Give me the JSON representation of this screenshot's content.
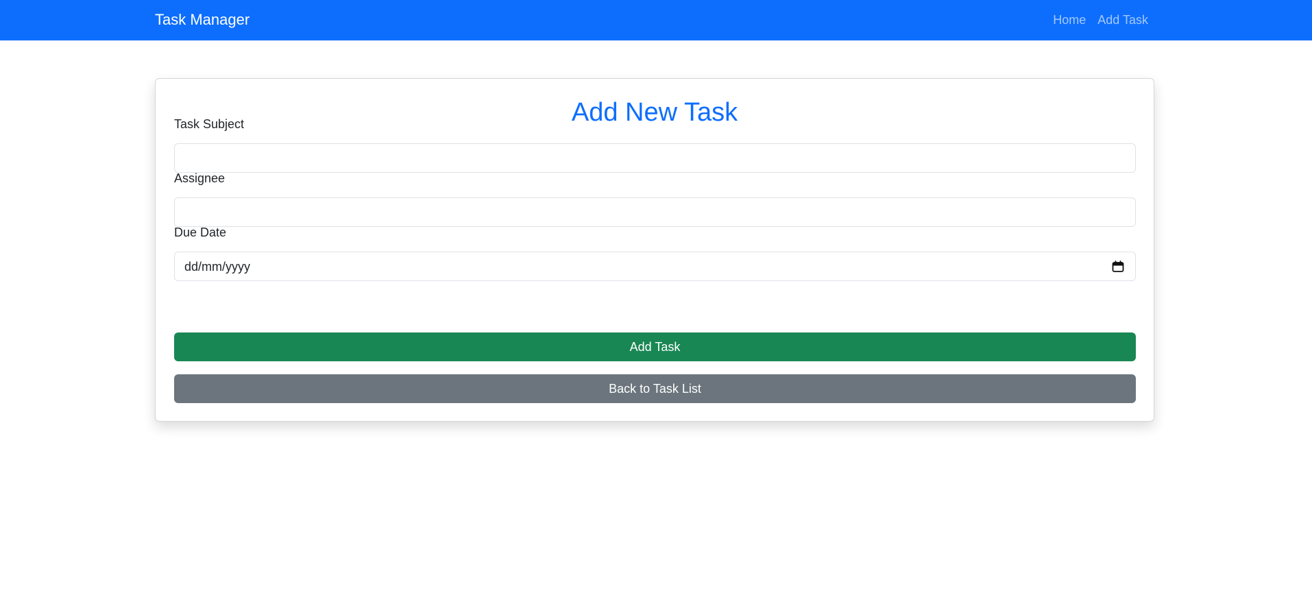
{
  "navbar": {
    "brand": "Task Manager",
    "links": [
      {
        "label": "Home"
      },
      {
        "label": "Add Task"
      }
    ]
  },
  "form": {
    "title": "Add New Task",
    "fields": {
      "subject": {
        "label": "Task Subject",
        "value": ""
      },
      "assignee": {
        "label": "Assignee",
        "value": ""
      },
      "due_date": {
        "label": "Due Date",
        "placeholder": "dd/mm/yyyy"
      }
    },
    "submit_label": "Add Task",
    "back_label": "Back to Task List"
  },
  "colors": {
    "navbar_bg": "#0d6efd",
    "title": "#0d6efd",
    "submit_bg": "#198754",
    "back_bg": "#6c757d"
  },
  "icons": {
    "date_picker": "calendar-icon"
  }
}
